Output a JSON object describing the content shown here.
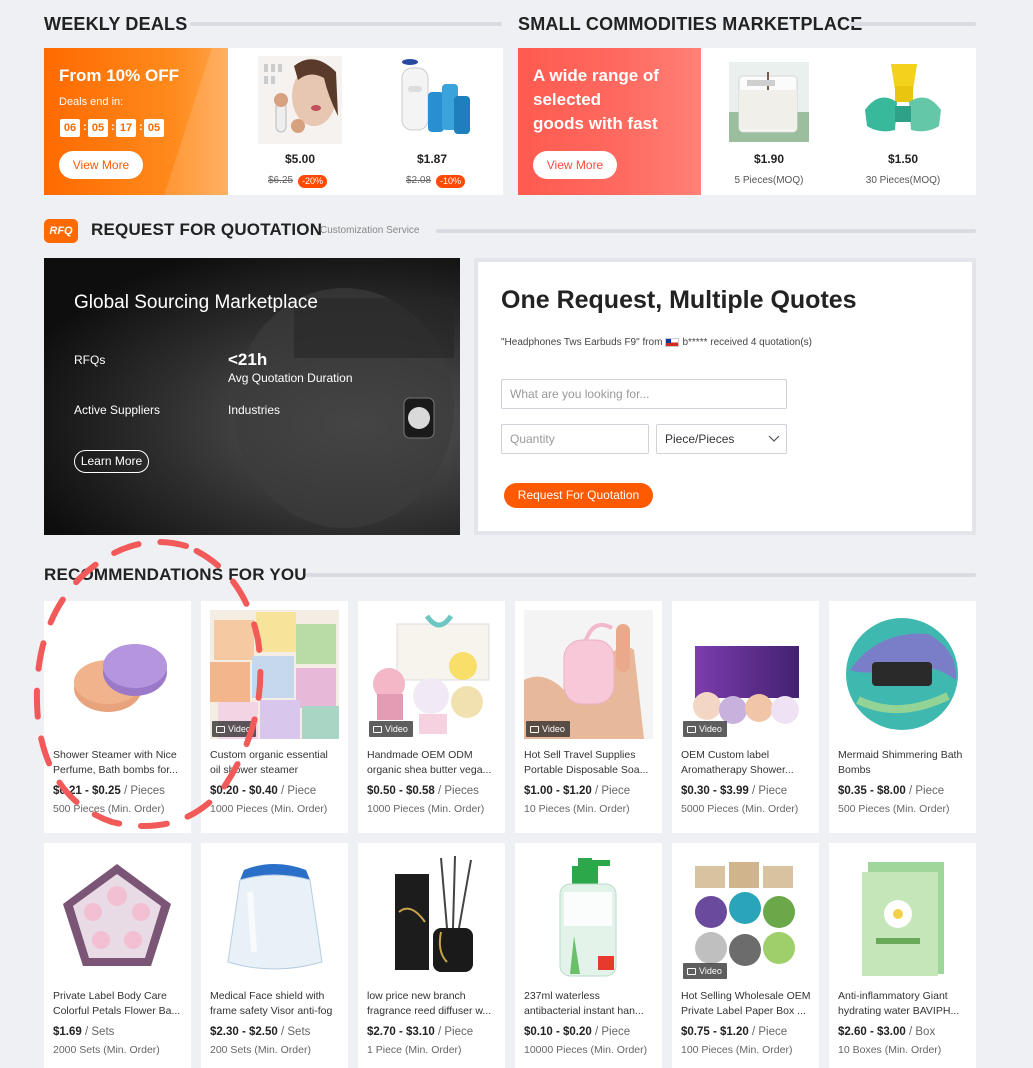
{
  "weekly_deals": {
    "title": "WEEKLY DEALS",
    "promo": {
      "headline": "From 10% OFF",
      "ends_label": "Deals end in:",
      "countdown": [
        "06",
        "05",
        "17",
        "05"
      ],
      "button": "View More"
    },
    "items": [
      {
        "price": "$5.00",
        "old_price": "$6.25",
        "discount": "-20%",
        "image": "beauty-device-image"
      },
      {
        "price": "$1.87",
        "old_price": "$2.08",
        "discount": "-10%",
        "image": "air-freshener-image"
      }
    ]
  },
  "small_commodities": {
    "title": "SMALL COMMODITIES MARKETPLACE",
    "promo": {
      "headline_lines": [
        "A wide range of",
        "selected",
        "goods with fast"
      ],
      "button": "View More"
    },
    "items": [
      {
        "price": "$1.90",
        "moq": "5 Pieces(MOQ)",
        "image": "candle-image"
      },
      {
        "price": "$1.50",
        "moq": "30 Pieces(MOQ)",
        "image": "neck-pillow-image"
      }
    ]
  },
  "rfq": {
    "logo": "RFQ",
    "title": "REQUEST FOR QUOTATION",
    "subtitle": "Customization Service",
    "banner": {
      "title": "Global Sourcing Marketplace",
      "stat1_label": "RFQs",
      "stat2_value": "<21h",
      "stat2_label": "Avg Quotation Duration",
      "stat3_label": "Active Suppliers",
      "stat4_label": "Industries",
      "button": "Learn More"
    },
    "form": {
      "heading": "One Request, Multiple Quotes",
      "recent_prefix": "\"Headphones Tws Earbuds F9\" from",
      "recent_suffix": "b***** received 4 quotation(s)",
      "search_placeholder": "What are you looking for...",
      "quantity_placeholder": "Quantity",
      "unit": "Piece/Pieces",
      "button": "Request For Quotation"
    }
  },
  "recommendations": {
    "title": "RECOMMENDATIONS FOR YOU",
    "video_label": "Video",
    "products": [
      {
        "line1": "Shower Steamer with Nice",
        "line2": "Perfume, Bath bombs for...",
        "price": "$0.21 - $0.25",
        "unit": "/ Pieces",
        "moq": "500 Pieces (Min. Order)",
        "video": false,
        "image": "shower-steamer-image"
      },
      {
        "line1": "Custom organic essential",
        "line2": "oil shower steamer",
        "price": "$0.20 - $0.40",
        "unit": "/ Piece",
        "moq": "1000 Pieces (Min. Order)",
        "video": true,
        "image": "pastel-cubes-image"
      },
      {
        "line1": "Handmade OEM ODM",
        "line2": "organic shea butter vega...",
        "price": "$0.50 - $0.58",
        "unit": "/ Pieces",
        "moq": "1000 Pieces (Min. Order)",
        "video": true,
        "image": "bath-bomb-gift-image"
      },
      {
        "line1": "Hot Sell Travel Supplies",
        "line2": "Portable Disposable Soa...",
        "price": "$1.00 - $1.20",
        "unit": "/ Piece",
        "moq": "10 Pieces (Min. Order)",
        "video": true,
        "image": "paper-soap-image"
      },
      {
        "line1": "OEM Custom label",
        "line2": "Aromatherapy Shower...",
        "price": "$0.30 - $3.99",
        "unit": "/ Piece",
        "moq": "5000 Pieces (Min. Order)",
        "video": true,
        "image": "shower-steamers-box-image"
      },
      {
        "line1": "Mermaid Shimmering Bath",
        "line2": "Bombs",
        "price": "$0.35 - $8.00",
        "unit": "/ Piece",
        "moq": "500 Pieces (Min. Order)",
        "video": false,
        "image": "mermaid-bath-bomb-image"
      },
      {
        "line1": "Private Label Body Care",
        "line2": "Colorful Petals Flower Ba...",
        "price": "$1.69",
        "unit": "/ Sets",
        "moq": "2000 Sets (Min. Order)",
        "video": false,
        "image": "pentagon-gift-set-image"
      },
      {
        "line1": "Medical Face shield with",
        "line2": "frame safety Visor anti-fog",
        "price": "$2.30 - $2.50",
        "unit": "/ Sets",
        "moq": "200 Sets (Min. Order)",
        "video": false,
        "image": "face-shield-image"
      },
      {
        "line1": "low price new branch",
        "line2": "fragrance reed diffuser w...",
        "price": "$2.70 - $3.10",
        "unit": "/ Piece",
        "moq": "1 Piece (Min. Order)",
        "video": false,
        "image": "reed-diffuser-image"
      },
      {
        "line1": "237ml waterless",
        "line2": "antibacterial instant han...",
        "price": "$0.10 - $0.20",
        "unit": "/ Piece",
        "moq": "10000 Pieces (Min. Order)",
        "video": false,
        "image": "hand-sanitizer-image"
      },
      {
        "line1": "Hot Selling Wholesale OEM",
        "line2": "Private Label Paper Box ...",
        "price": "$0.75 - $1.20",
        "unit": "/ Piece",
        "moq": "100 Pieces (Min. Order)",
        "video": true,
        "image": "soap-bars-image"
      },
      {
        "line1": "Anti-inflammatory Giant",
        "line2": "hydrating water BAVIPH...",
        "price": "$2.60 - $3.00",
        "unit": "/ Box",
        "moq": "10 Boxes (Min. Order)",
        "video": false,
        "image": "face-mask-image"
      }
    ]
  },
  "colors": {
    "accent": "#ff6a00",
    "commodities": "#ff5a4f",
    "annotation": "#f25a5a"
  }
}
